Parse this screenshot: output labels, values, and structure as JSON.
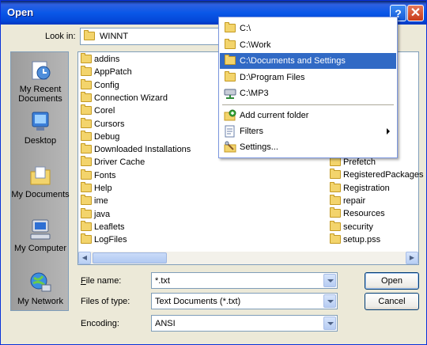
{
  "window": {
    "title": "Open",
    "help": "?",
    "close": "✕"
  },
  "look_in": {
    "label": "Look in:",
    "value": "WINNT"
  },
  "places": [
    {
      "label": "My Recent Documents",
      "icon": "recent-documents-icon"
    },
    {
      "label": "Desktop",
      "icon": "desktop-icon"
    },
    {
      "label": "My Documents",
      "icon": "my-documents-icon"
    },
    {
      "label": "My Computer",
      "icon": "my-computer-icon"
    },
    {
      "label": "My Network",
      "icon": "my-network-icon"
    }
  ],
  "files_left": [
    "addins",
    "AppPatch",
    "Config",
    "Connection Wizard",
    "Corel",
    "Cursors",
    "Debug",
    "Downloaded Installations",
    "Driver Cache",
    "Fonts",
    "Help",
    "ime",
    "java",
    "Leaflets",
    "LogFiles"
  ],
  "files_right": [
    "Prefetch",
    "RegisteredPackages",
    "Registration",
    "repair",
    "Resources",
    "security",
    "setup.pss"
  ],
  "file_name": {
    "label": "File name:",
    "value": "*.txt"
  },
  "file_type": {
    "label": "Files of type:",
    "value": "Text Documents (*.txt)"
  },
  "encoding": {
    "label": "Encoding:",
    "value": "ANSI"
  },
  "buttons": {
    "open": "Open",
    "cancel": "Cancel"
  },
  "menu": {
    "items": [
      {
        "label": "C:\\",
        "icon": "folder-icon"
      },
      {
        "label": "C:\\Work",
        "icon": "folder-icon"
      },
      {
        "label": "C:\\Documents and Settings",
        "icon": "folder-icon",
        "selected": true
      },
      {
        "label": "D:\\Program Files",
        "icon": "folder-icon"
      },
      {
        "label": "C:\\MP3",
        "icon": "network-drive-icon"
      }
    ],
    "actions": [
      {
        "label": "Add current folder",
        "icon": "add-folder-icon"
      },
      {
        "label": "Filters",
        "icon": "filter-icon",
        "submenu": true
      },
      {
        "label": "Settings...",
        "icon": "settings-icon"
      }
    ]
  },
  "colors": {
    "accent": "#316AC5",
    "titlebar": "#0A58E8",
    "folder": "#F3D46C"
  }
}
